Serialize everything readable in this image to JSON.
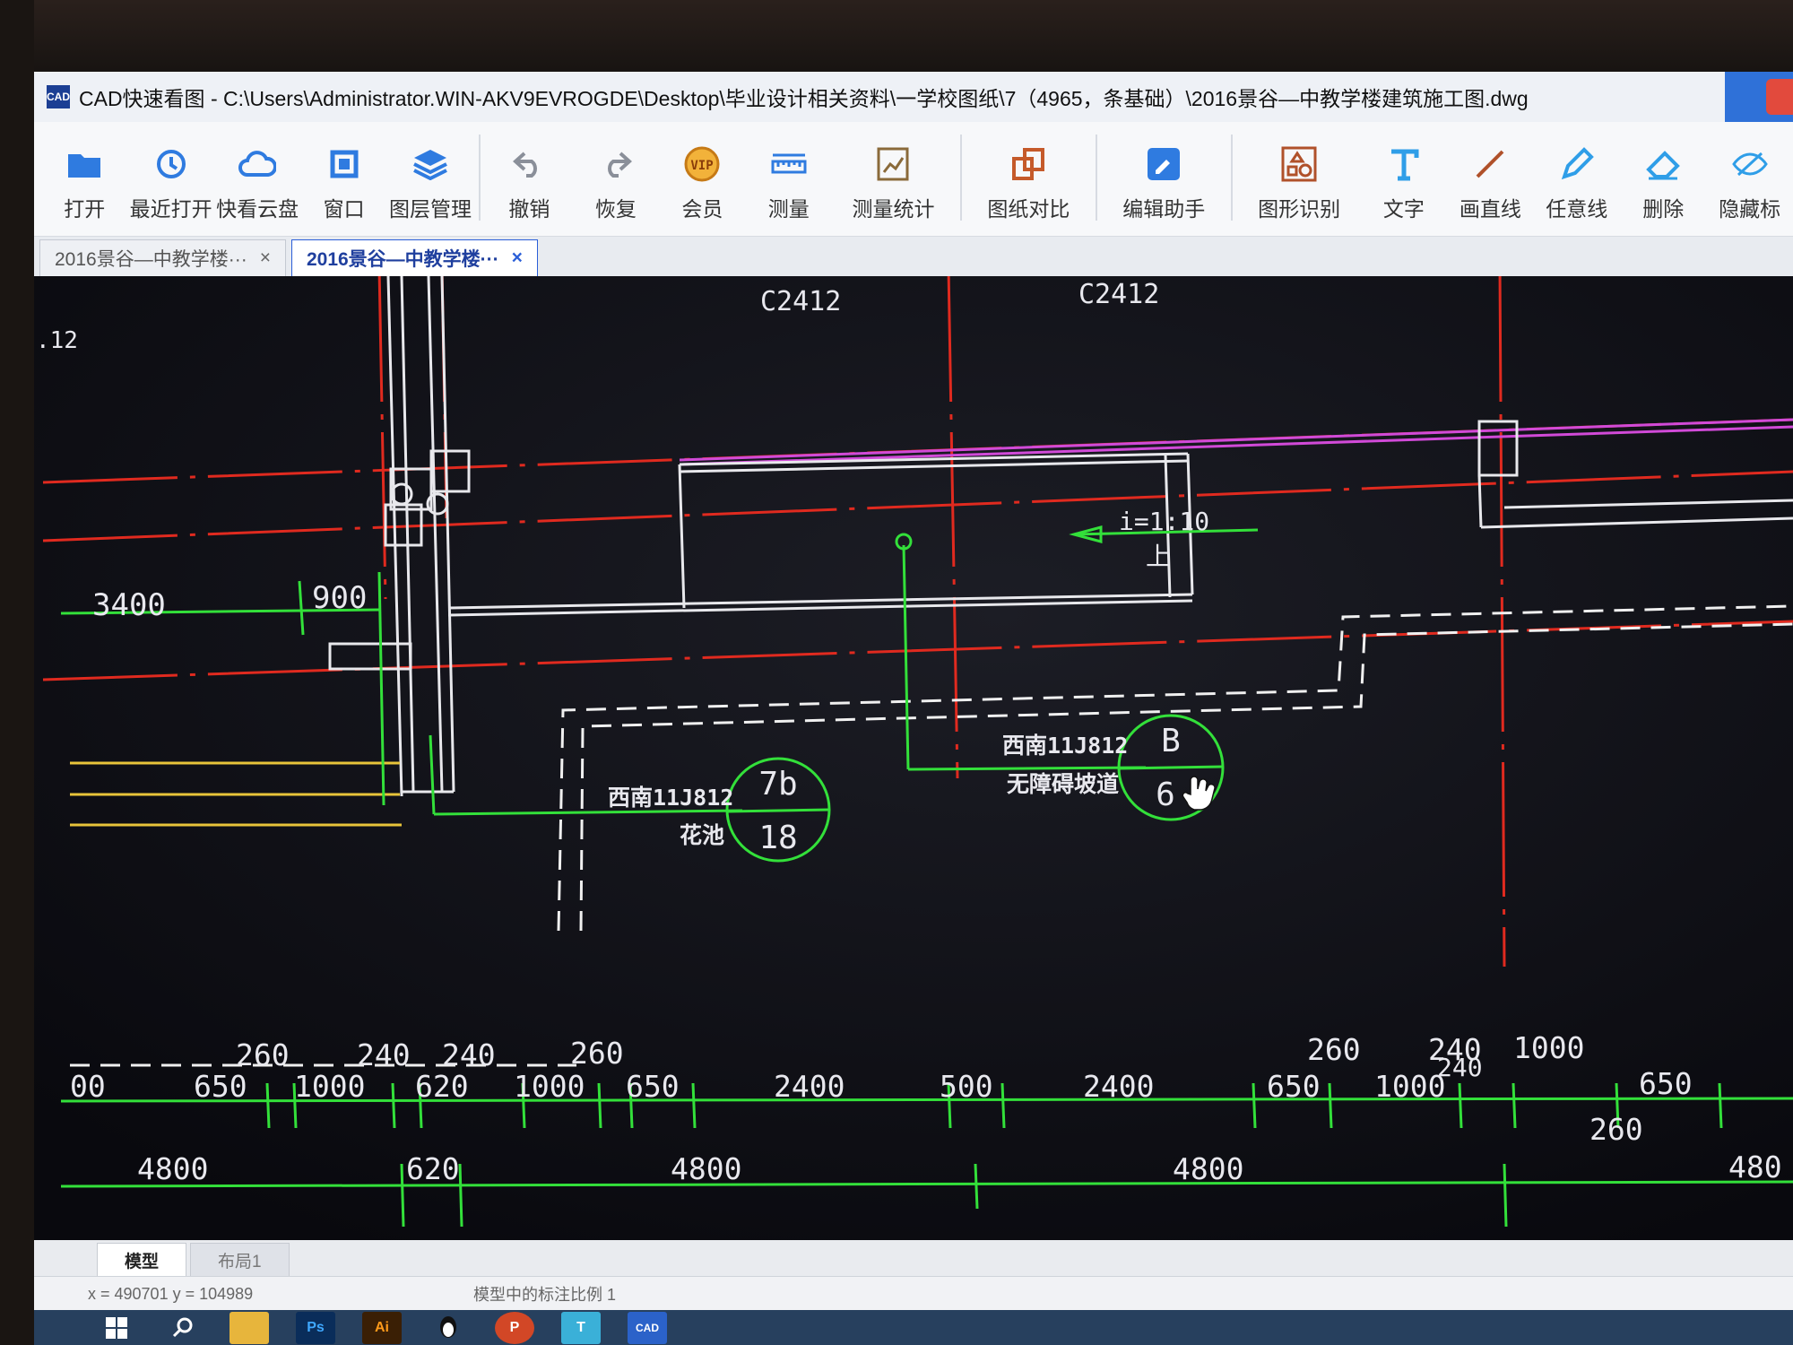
{
  "window": {
    "title": "CAD快速看图 - C:\\Users\\Administrator.WIN-AKV9EVROGDE\\Desktop\\毕业设计相关资料\\一学校图纸\\7（4965，条基础）\\2016景谷—中教学楼建筑施工图.dwg",
    "app_icon_text": "CAD"
  },
  "toolbar": {
    "open": "打开",
    "recent": "最近打开",
    "cloud": "快看云盘",
    "window": "窗口",
    "layers": "图层管理",
    "undo": "撤销",
    "redo": "恢复",
    "vip": "会员",
    "vip_badge": "VIP",
    "measure": "测量",
    "measure_stats": "测量统计",
    "compare": "图纸对比",
    "edit_helper": "编辑助手",
    "shape_recog": "图形识别",
    "text": "文字",
    "line": "画直线",
    "freeline": "任意线",
    "delete": "删除",
    "hide_mark": "隐藏标"
  },
  "tabs": [
    {
      "label": "2016景谷—中教学楼···",
      "close": "×"
    },
    {
      "label": "2016景谷—中教学楼···",
      "close": "×"
    }
  ],
  "drawing": {
    "window_tag_1": "C2412",
    "window_tag_2": "C2412",
    "edge_label": ".12",
    "slope": "i=1:10",
    "slope_up": "上",
    "dim_3400": "3400",
    "dim_900": "900",
    "callout_a": {
      "ref": "西南11J812",
      "desc": "花池",
      "top": "7b",
      "bottom": "18"
    },
    "callout_b": {
      "ref": "西南11J812",
      "desc": "无障碍坡道",
      "top": "B",
      "bottom": "6"
    },
    "row1": [
      "260",
      "240",
      "240",
      "260",
      "260",
      "240",
      "1000",
      "240"
    ],
    "row2": [
      "00",
      "650",
      "1000",
      "620",
      "1000",
      "650",
      "2400",
      "500",
      "2400",
      "650",
      "1000",
      "650"
    ],
    "row2_extra": "260",
    "row3": [
      "4800",
      "620",
      "4800",
      "4800",
      "480"
    ]
  },
  "layout_tabs": [
    "模型",
    "布局1"
  ],
  "status": {
    "coords": "x = 490701  y = 104989",
    "scale": "模型中的标注比例 1"
  },
  "taskbar": {
    "ps": "Ps",
    "ai": "Ai",
    "ppt": "P",
    "cad": "CAD"
  }
}
